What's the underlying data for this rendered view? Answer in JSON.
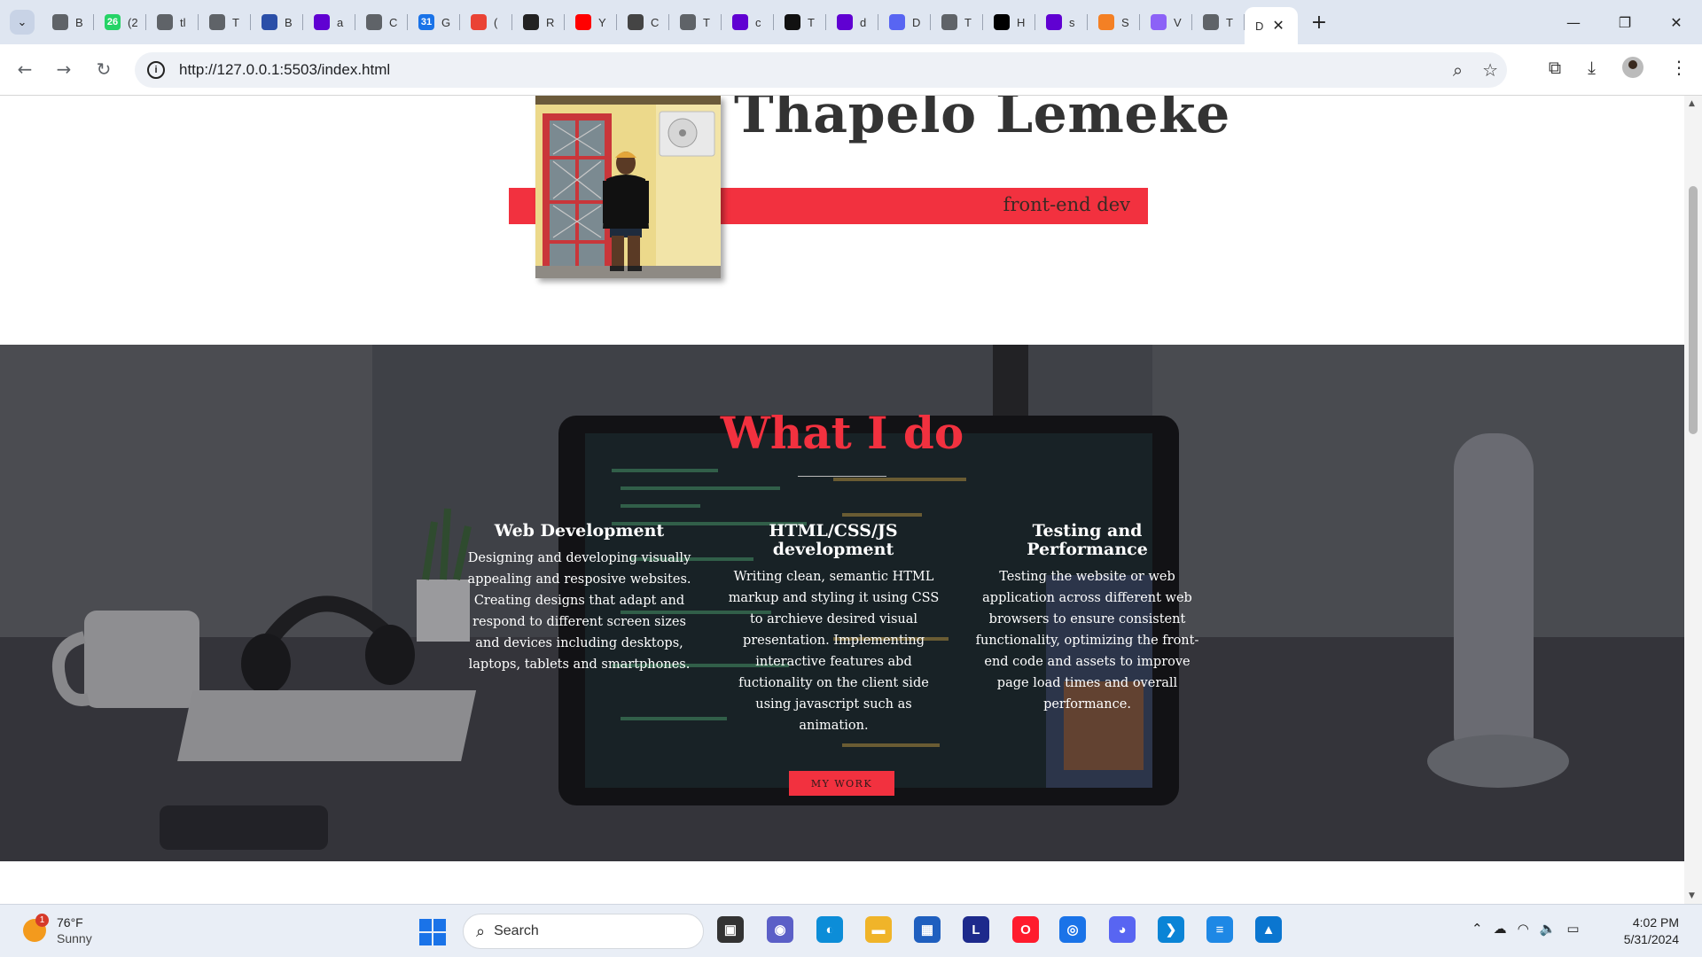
{
  "browser": {
    "tabs": [
      {
        "icon": "chrome-icon",
        "label": "B",
        "color": "#5f6368"
      },
      {
        "icon": "whatsapp-icon",
        "label": "(2",
        "color": "#25d366",
        "badge": "26"
      },
      {
        "icon": "web-icon",
        "label": "tl",
        "color": "#5f6368"
      },
      {
        "icon": "web-icon",
        "label": "T",
        "color": "#5f6368"
      },
      {
        "icon": "bookmark-app-icon",
        "label": "B",
        "color": "#2b4fa8"
      },
      {
        "icon": "yahoo-icon",
        "label": "a",
        "color": "#6001d2"
      },
      {
        "icon": "web-icon",
        "label": "C",
        "color": "#5f6368"
      },
      {
        "icon": "google-calendar-icon",
        "label": "G",
        "color": "#1a73e8",
        "badge": "31"
      },
      {
        "icon": "gmail-icon",
        "label": "(",
        "color": "#ea4335"
      },
      {
        "icon": "github-icon",
        "label": "R",
        "color": "#222222"
      },
      {
        "icon": "youtube-icon",
        "label": "Y",
        "color": "#ff0000"
      },
      {
        "icon": "openai-icon",
        "label": "C",
        "color": "#444444"
      },
      {
        "icon": "web-icon",
        "label": "T",
        "color": "#5f6368"
      },
      {
        "icon": "yahoo-icon",
        "label": "c",
        "color": "#6001d2"
      },
      {
        "icon": "openai-icon",
        "label": "T",
        "color": "#111111"
      },
      {
        "icon": "yahoo-icon",
        "label": "d",
        "color": "#6001d2"
      },
      {
        "icon": "discord-icon",
        "label": "D",
        "color": "#5865f2"
      },
      {
        "icon": "web-icon",
        "label": "T",
        "color": "#5f6368"
      },
      {
        "icon": "x-icon",
        "label": "H",
        "color": "#000000"
      },
      {
        "icon": "yahoo-icon",
        "label": "s",
        "color": "#6001d2"
      },
      {
        "icon": "stackoverflow-icon",
        "label": "S",
        "color": "#f48024"
      },
      {
        "icon": "vite-icon",
        "label": "V",
        "color": "#8c62f7"
      },
      {
        "icon": "web-icon",
        "label": "T",
        "color": "#5f6368"
      }
    ],
    "active_tab": {
      "label": "D",
      "close": "✕"
    },
    "new_tab": "+",
    "window": {
      "minimize": "—",
      "restore": "❐",
      "close": "✕"
    },
    "url": "http://127.0.0.1:5503/index.html"
  },
  "hero": {
    "name": "Thapelo Lemeke",
    "role": "front-end dev",
    "accent": "#f2313f"
  },
  "services": {
    "title": "What I do",
    "items": [
      {
        "title": "Web Development",
        "text": "Designing and developing visually appealing and resposive websites. Creating designs that adapt and respond to different screen sizes and devices including desktops, laptops, tablets and smartphones."
      },
      {
        "title": "HTML/CSS/JS development",
        "text": "Writing clean, semantic HTML markup and styling it using CSS to archieve desired visual presentation. Implementing interactive features abd fuctionality on the client side using javascript such as animation."
      },
      {
        "title": "Testing and Performance",
        "text": "Testing the website or web application across different web browsers to ensure consistent functionality, optimizing the front-end code and assets to improve page load times and overall performance."
      }
    ],
    "button": "MY WORK"
  },
  "taskbar": {
    "weather": {
      "temp": "76°F",
      "condition": "Sunny",
      "badge": "1"
    },
    "search_label": "Search",
    "apps": [
      {
        "name": "task-view-icon",
        "glyph": "▣",
        "color": "#333333"
      },
      {
        "name": "teams-icon",
        "glyph": "◉",
        "color": "#5b5fc7"
      },
      {
        "name": "edge-icon",
        "glyph": "◐",
        "color": "#0c8dd8"
      },
      {
        "name": "file-explorer-icon",
        "glyph": "▬",
        "color": "#f0b429"
      },
      {
        "name": "store-icon",
        "glyph": "▦",
        "color": "#1f5fbf"
      },
      {
        "name": "l-app-icon",
        "glyph": "L",
        "color": "#1d2a8c"
      },
      {
        "name": "opera-icon",
        "glyph": "O",
        "color": "#ff1b2d"
      },
      {
        "name": "chrome-icon",
        "glyph": "◎",
        "color": "#1a73e8"
      },
      {
        "name": "discord-icon",
        "glyph": "◕",
        "color": "#5865f2"
      },
      {
        "name": "vscode-icon",
        "glyph": "❯",
        "color": "#0a84d6"
      },
      {
        "name": "notepad-icon",
        "glyph": "≡",
        "color": "#1e88e5"
      },
      {
        "name": "photos-icon",
        "glyph": "▲",
        "color": "#0b76d0"
      }
    ],
    "time": "4:02 PM",
    "date": "5/31/2024"
  }
}
